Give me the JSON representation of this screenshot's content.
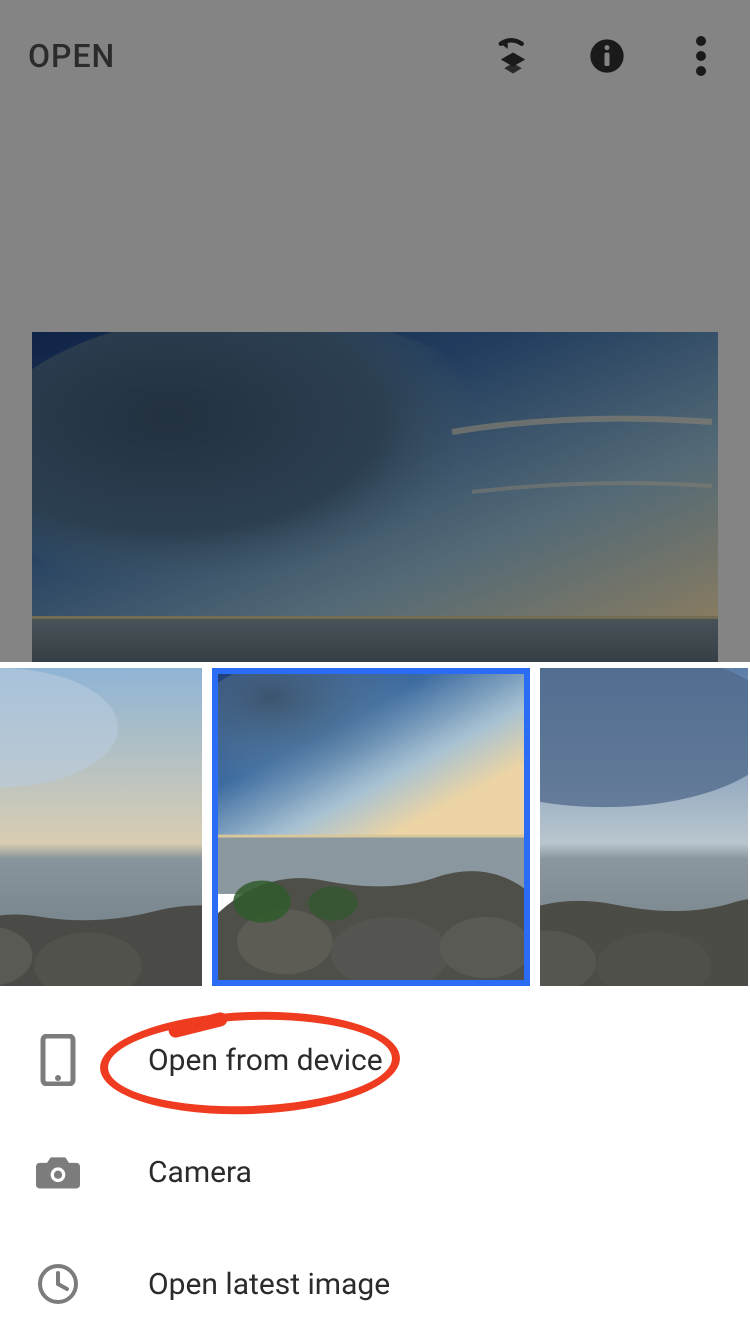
{
  "topbar": {
    "open_label": "OPEN"
  },
  "thumbnails": {
    "selected_index": 1
  },
  "menu": {
    "open_device": "Open from device",
    "camera": "Camera",
    "open_latest": "Open latest image"
  },
  "annotation": {
    "target": "open_device"
  }
}
